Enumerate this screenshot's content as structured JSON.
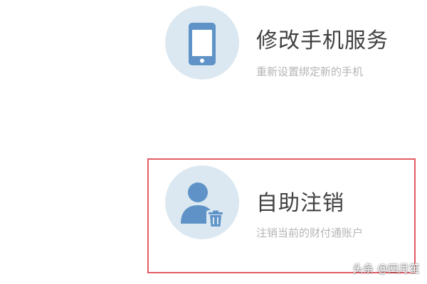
{
  "services": {
    "change_phone": {
      "icon": "phone-icon",
      "title": "修改手机服务",
      "description": "重新设置绑定新的手机"
    },
    "self_cancel": {
      "icon": "user-delete-icon",
      "title": "自助注销",
      "description": "注销当前的财付通账户"
    }
  },
  "watermark": "头条 @四月笙",
  "colors": {
    "icon_circle_bg": "#dbe8f1",
    "icon_blue": "#5f93c8",
    "title_text": "#404040",
    "desc_text": "#b5b5b5",
    "highlight_border": "#e35b64"
  }
}
